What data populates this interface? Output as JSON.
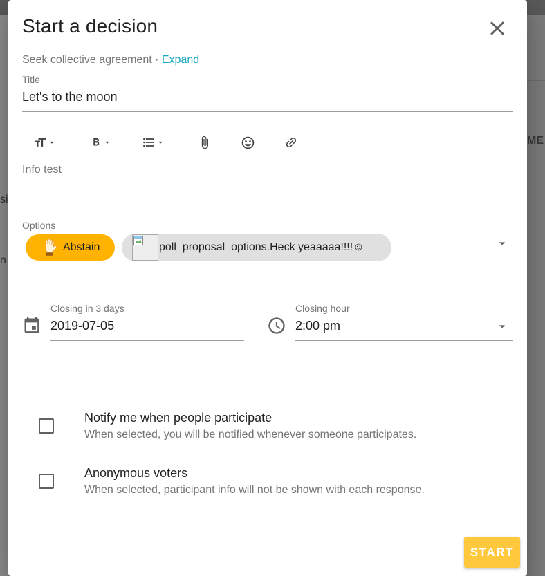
{
  "dialog": {
    "title": "Start a decision",
    "subtitle": "Seek collective agreement",
    "subtitle_separator": " · ",
    "expand_label": "Expand"
  },
  "title_field": {
    "label": "Title",
    "value": "Let's to the moon"
  },
  "toolbar": {
    "icons": [
      "text-size-icon",
      "bold-icon",
      "list-icon",
      "attach-icon",
      "emoji-icon",
      "link-icon"
    ]
  },
  "details": {
    "value": "Info test"
  },
  "options": {
    "label": "Options",
    "chips": [
      {
        "label": "Abstain",
        "icon": "raised-hand-icon",
        "color": "#ffb300"
      },
      {
        "label": "poll_proposal_options.Heck yeaaaaa!!!!☺",
        "icon": "broken-image-icon",
        "color": "#e0e0e0"
      }
    ]
  },
  "closing_date": {
    "label": "Closing in 3 days",
    "value": "2019-07-05"
  },
  "closing_hour": {
    "label": "Closing hour",
    "value": "2:00 pm"
  },
  "settings": [
    {
      "title": "Notify me when people participate",
      "description": "When selected, you will be notified whenever someone participates.",
      "checked": false
    },
    {
      "title": "Anonymous voters",
      "description": "When selected, participant info will not be shown with each response.",
      "checked": false
    }
  ],
  "actions": {
    "start_label": "START",
    "start_color": "#ffc83d"
  },
  "background": {
    "fragments": [
      "ME",
      "si",
      "n"
    ]
  },
  "colors": {
    "accent": "#1aa7c2",
    "abstain": "#ffb300"
  }
}
